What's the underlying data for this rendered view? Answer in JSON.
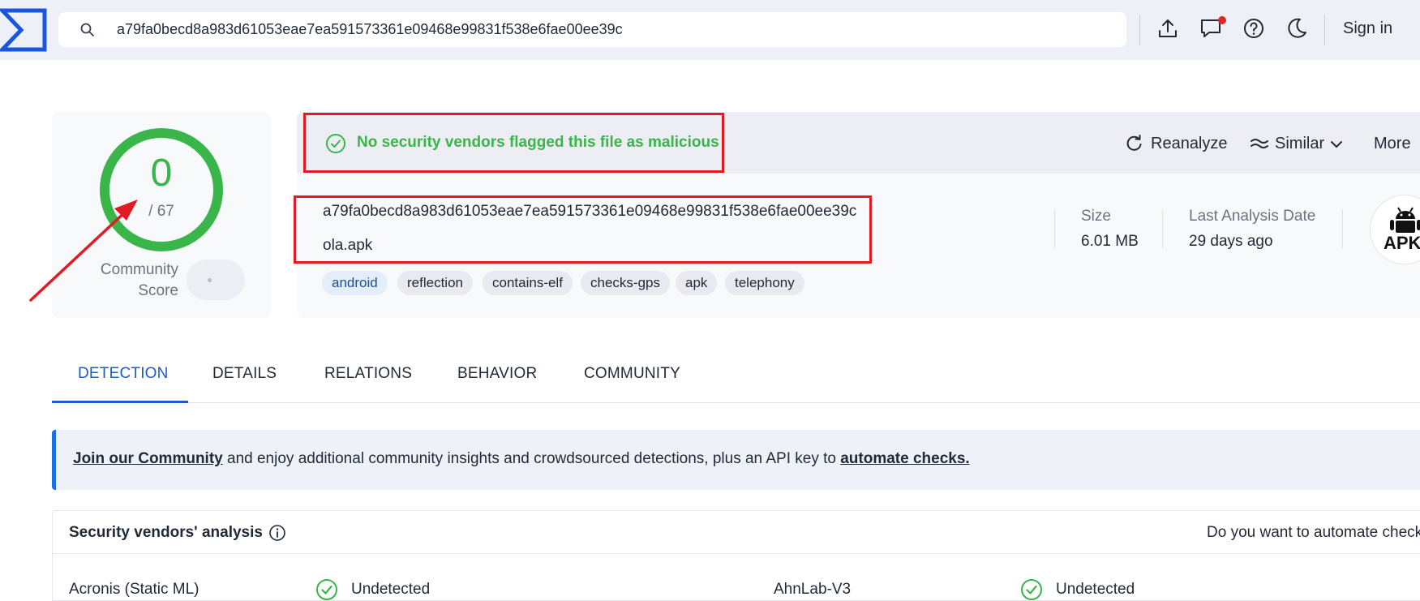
{
  "header": {
    "search_value": "a79fa0becd8a983d61053eae7ea591573361e09468e99831f538e6fae00ee39c",
    "sign_in_label": "Sign in"
  },
  "score": {
    "value": "0",
    "total": "/ 67",
    "community_label": "Community Score"
  },
  "verdict": {
    "text": "No security vendors flagged this file as malicious"
  },
  "actions": {
    "reanalyze": "Reanalyze",
    "similar": "Similar",
    "more": "More"
  },
  "file": {
    "hash": "a79fa0becd8a983d61053eae7ea591573361e09468e99831f538e6fae00ee39c",
    "name": "ola.apk",
    "tags": [
      "android",
      "reflection",
      "contains-elf",
      "checks-gps",
      "apk",
      "telephony"
    ],
    "size_label": "Size",
    "size_value": "6.01 MB",
    "last_analysis_label": "Last Analysis Date",
    "last_analysis_value": "29 days ago",
    "type_badge": "APK"
  },
  "tabs": [
    "DETECTION",
    "DETAILS",
    "RELATIONS",
    "BEHAVIOR",
    "COMMUNITY"
  ],
  "banner": {
    "link_community": "Join our Community",
    "middle_text": " and enjoy additional community insights and crowdsourced detections, plus an API key to ",
    "link_automate": "automate checks."
  },
  "vendors": {
    "title": "Security vendors' analysis",
    "automate_prompt": "Do you want to automate checks",
    "rows": [
      {
        "name": "Acronis (Static ML)",
        "result": "Undetected"
      },
      {
        "name": "AhnLab-V3",
        "result": "Undetected"
      }
    ]
  },
  "colors": {
    "accent": "#1d5bc6",
    "clean": "#3ab54a",
    "annotation": "#e01b24",
    "topbar": "#eef0f7"
  },
  "icons": [
    "logo-icon",
    "search-icon",
    "upload-icon",
    "chat-icon",
    "help-icon",
    "moon-icon",
    "check-circle-icon",
    "reanalyze-icon",
    "similar-icon",
    "chevron-down-icon",
    "android-icon",
    "info-icon"
  ]
}
